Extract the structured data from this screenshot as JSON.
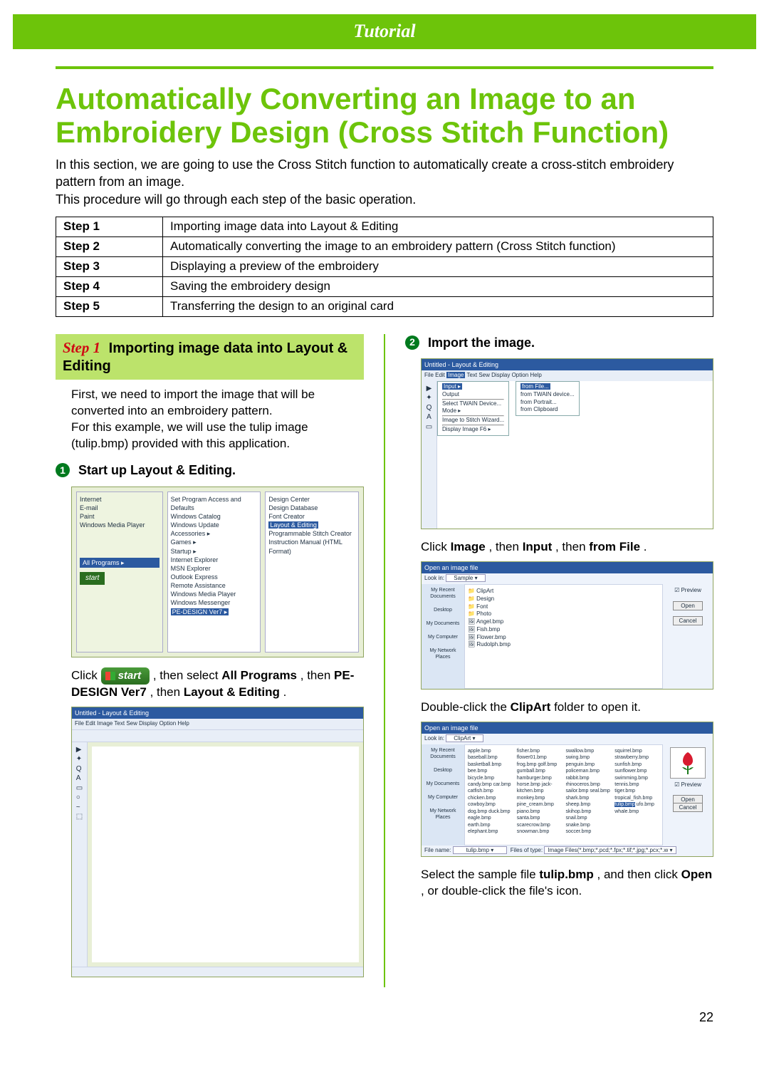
{
  "header": {
    "banner": "Tutorial"
  },
  "title": "Automatically Converting an Image to an Embroidery Design (Cross Stitch Function)",
  "intro_p1": "In this section, we are going to use the Cross Stitch function to automatically create a cross-stitch embroidery pattern from an image.",
  "intro_p2": "This procedure will go through each step of the basic operation.",
  "steps_table": [
    {
      "label": "Step 1",
      "desc": "Importing image data into Layout & Editing"
    },
    {
      "label": "Step 2",
      "desc": "Automatically converting the image to an embroidery pattern (Cross Stitch function)"
    },
    {
      "label": "Step 3",
      "desc": "Displaying a preview of the embroidery"
    },
    {
      "label": "Step 4",
      "desc": "Saving the embroidery design"
    },
    {
      "label": "Step 5",
      "desc": "Transferring the design to an original card"
    }
  ],
  "left": {
    "step_label": "Step 1",
    "step_title": "Importing image data into Layout & Editing",
    "para1": "First, we need to import the image that will be converted into an embroidery pattern.",
    "para2": "For this example, we will use the tulip image (tulip.bmp) provided with this application.",
    "bullet1_num": "1",
    "bullet1_text": "Start up Layout & Editing.",
    "click_word": "Click ",
    "start_label": "start",
    "after_start_1": ", then select ",
    "bold_allprog": "All Programs",
    "comma1": ", then ",
    "bold_pedesign": "PE-DESIGN Ver7",
    "comma2": ", then ",
    "bold_layout": "Layout & Editing",
    "period": "."
  },
  "right": {
    "bullet2_num": "2",
    "bullet2_text": "Import the image.",
    "instr1_pre": "Click ",
    "instr1_b1": "Image",
    "instr1_mid": ", then ",
    "instr1_b2": "Input",
    "instr1_mid2": ", then ",
    "instr1_b3": "from File",
    "instr1_post": ".",
    "instr2_pre": "Double-click the ",
    "instr2_b1": "ClipArt",
    "instr2_post": " folder to open it.",
    "instr3_pre": "Select the sample file ",
    "instr3_b1": "tulip.bmp",
    "instr3_mid": ", and then click ",
    "instr3_b2": "Open",
    "instr3_post": ", or double-click the file's icon."
  },
  "page_number": "22"
}
